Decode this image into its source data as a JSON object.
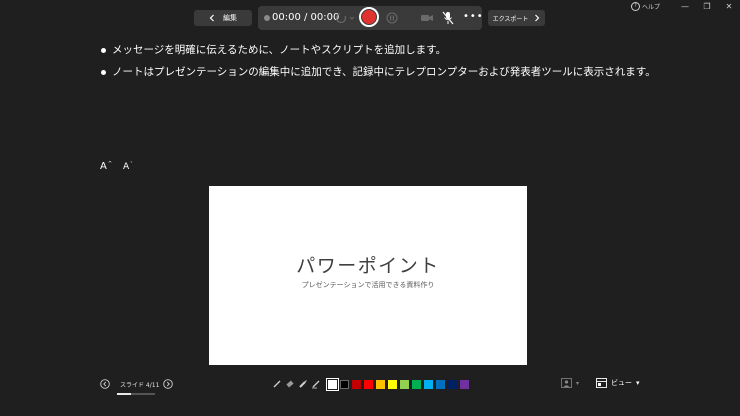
{
  "window": {
    "help_label": "ヘルプ",
    "minimize_glyph": "—",
    "restore_glyph": "❐",
    "close_glyph": "✕"
  },
  "toolbar": {
    "back_label": "編集",
    "timer": "00:00 / 00:00",
    "more_glyph": "•••",
    "export_label": "エクスポート"
  },
  "notes": [
    "メッセージを明確に伝えるために、ノートやスクリプトを追加します。",
    "ノートはプレゼンテーションの編集中に追加でき、記録中にテレプロンプターおよび発表者ツールに表示されます。"
  ],
  "font_controls": {
    "increase": "A",
    "decrease": "A",
    "increase_mark": "^",
    "decrease_mark": "ˇ"
  },
  "slide": {
    "title": "パワーポイント",
    "subtitle": "プレゼンテーションで活用できる資料作り"
  },
  "navigation": {
    "slide_counter": "スライド 4/11",
    "current": 4,
    "total": 11
  },
  "pen_colors": [
    "#ffffff",
    "#000000",
    "#c00000",
    "#ff0000",
    "#ffc000",
    "#ffff00",
    "#92d050",
    "#00b050",
    "#00b0f0",
    "#0070c0",
    "#002060",
    "#7030a0"
  ],
  "view": {
    "label": "ビュー",
    "arrow": "▾"
  },
  "camera": {
    "arrow": "▾"
  },
  "colors": {
    "record": "#e0332f",
    "background": "#1f1f1f",
    "panel": "#3a3a3a"
  }
}
